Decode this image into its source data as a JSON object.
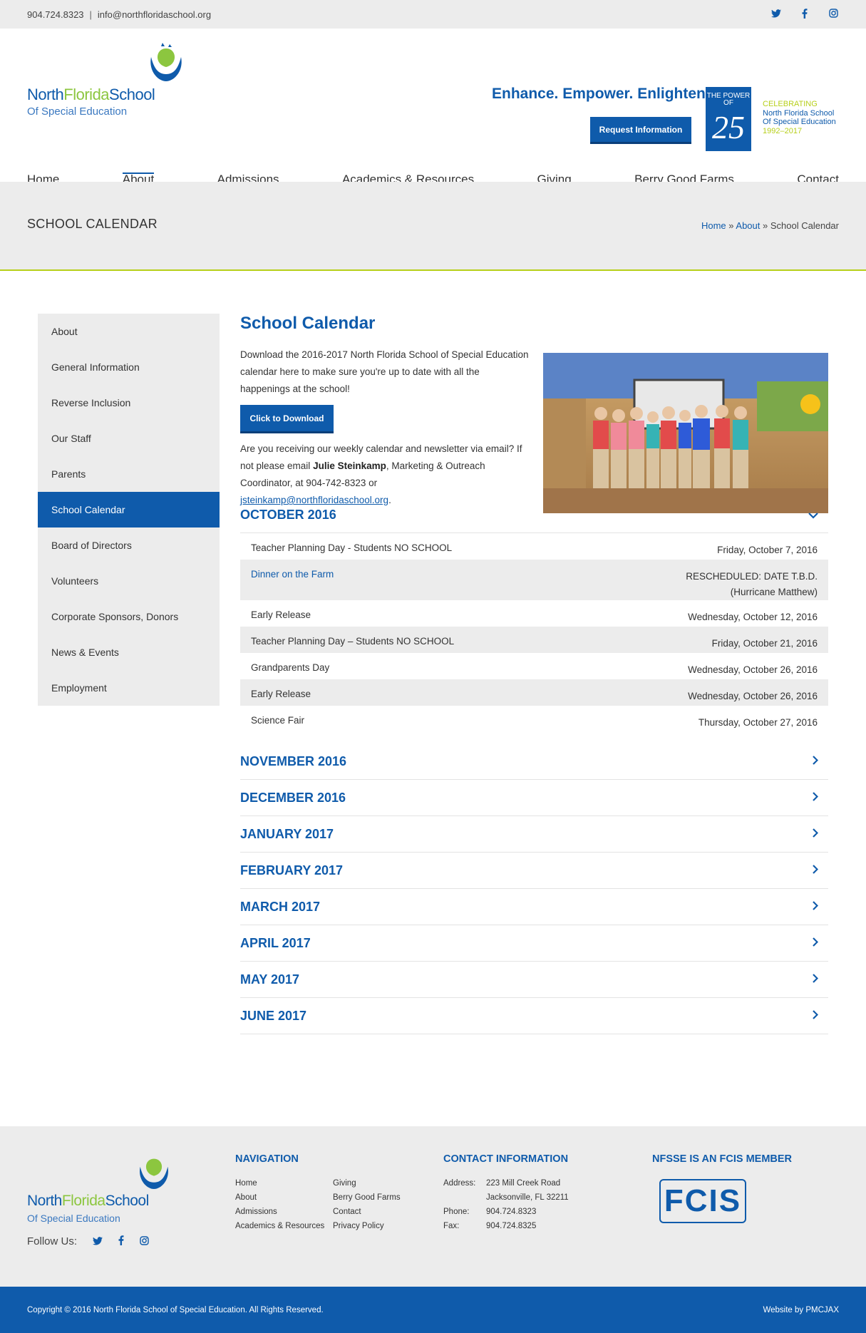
{
  "topbar": {
    "phone": "904.724.8323",
    "email": "info@northfloridaschool.org"
  },
  "social": [
    "twitter-icon",
    "facebook-icon",
    "instagram-icon"
  ],
  "logo": {
    "name_a": "North",
    "name_b": "Florida",
    "name_c": "School",
    "sub": "Of Special Education"
  },
  "header": {
    "tagline": "Enhance. Empower. Enlighten.",
    "request_btn": "Request Information",
    "badge_top": "THE POWER OF",
    "badge_num": "25",
    "celebrating": "CELEBRATING",
    "celeb_line1": "North Florida School",
    "celeb_line2": "Of Special Education",
    "celeb_years": "1992–2017"
  },
  "nav": [
    "Home",
    "About",
    "Admissions",
    "Academics & Resources",
    "Giving",
    "Berry Good Farms",
    "Contact"
  ],
  "pagehead": {
    "title": "SCHOOL CALENDAR",
    "crumb_home": "Home",
    "crumb_about": "About",
    "crumb_sep": "»",
    "crumb_current": "School Calendar"
  },
  "sidebar": [
    "About",
    "General Information",
    "Reverse Inclusion",
    "Our Staff",
    "Parents",
    "School Calendar",
    "Board of Directors",
    "Volunteers",
    "Corporate Sponsors, Donors",
    "News & Events",
    "Employment"
  ],
  "content": {
    "heading": "School Calendar",
    "intro": "Download the 2016-2017 North Florida School of Special Education calendar here to make sure you're up to date with all the happenings at the school!",
    "download_btn": "Click to Download",
    "intro2_a": "Are you receiving our weekly calendar and newsletter via email? If not please email ",
    "intro2_name": "Julie Steinkamp",
    "intro2_b": ", Marketing & Outreach Coordinator, at 904-742-8323 or ",
    "intro2_email": "jsteinkamp@northfloridaschool.org",
    "intro2_end": "."
  },
  "october": {
    "title": "OCTOBER 2016",
    "events": [
      {
        "name": "Teacher Planning Day - Students NO SCHOOL",
        "date": "Friday, October 7, 2016"
      },
      {
        "name": "Dinner on the Farm",
        "date": "RESCHEDULED: DATE T.B.D.",
        "date2": "(Hurricane Matthew)"
      },
      {
        "name": "Early Release",
        "date": "Wednesday, October 12, 2016"
      },
      {
        "name": "Teacher Planning Day – Students NO SCHOOL",
        "date": "Friday, October 21, 2016"
      },
      {
        "name": "Grandparents Day",
        "date": "Wednesday, October 26, 2016"
      },
      {
        "name": "Early Release",
        "date": "Wednesday, October 26, 2016"
      },
      {
        "name": "Science Fair",
        "date": "Thursday, October 27, 2016"
      }
    ]
  },
  "months": [
    "NOVEMBER 2016",
    "DECEMBER 2016",
    "JANUARY 2017",
    "FEBRUARY 2017",
    "MARCH 2017",
    "APRIL 2017",
    "MAY 2017",
    "JUNE 2017"
  ],
  "footer": {
    "follow": "Follow Us:",
    "nav_title": "NAVIGATION",
    "nav_col1": [
      "Home",
      "About",
      "Admissions",
      "Academics & Resources"
    ],
    "nav_col2": [
      "Giving",
      "Berry Good Farms",
      "Contact",
      "Privacy Policy"
    ],
    "contact_title": "CONTACT INFORMATION",
    "address_label": "Address:",
    "address1": "223 Mill Creek Road",
    "address2": "Jacksonville, FL 32211",
    "phone_label": "Phone:",
    "phone": "904.724.8323",
    "fax_label": "Fax:",
    "fax": "904.724.8325",
    "fcis_title": "NFSSE IS AN FCIS MEMBER",
    "fcis_logo": "FCIS",
    "copyright": "Copyright © 2016 North Florida School of Special Education. All Rights Reserved.",
    "credit": "Website by PMCJAX"
  }
}
